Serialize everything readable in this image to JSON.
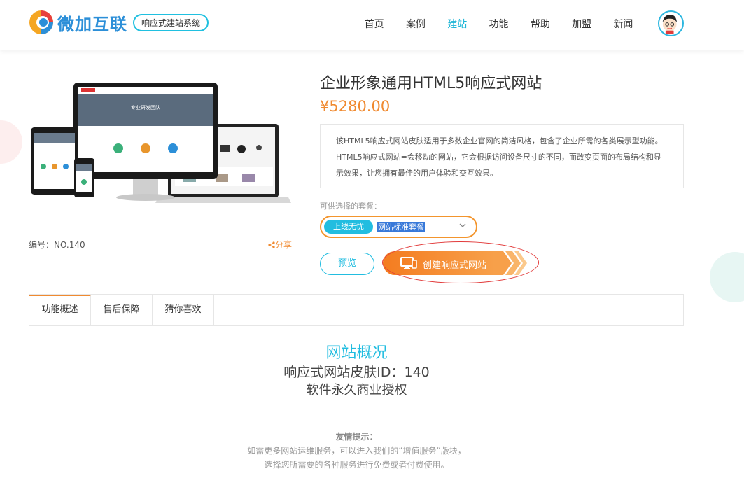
{
  "header": {
    "logo_text": "微加互联",
    "logo_badge": "响应式建站系统",
    "nav": [
      {
        "label": "首页",
        "active": false
      },
      {
        "label": "案例",
        "active": false
      },
      {
        "label": "建站",
        "active": true
      },
      {
        "label": "功能",
        "active": false
      },
      {
        "label": "帮助",
        "active": false
      },
      {
        "label": "加盟",
        "active": false
      },
      {
        "label": "新闻",
        "active": false
      }
    ],
    "avatar_icon": "user-avatar-icon"
  },
  "product": {
    "title": "企业形象通用HTML5响应式网站",
    "price": "¥5280.00",
    "code": "编号：NO.140",
    "share": "分享",
    "screen_banner_text": "专业研发团队",
    "description_line1": "该HTML5响应式网站皮肤适用于多数企业官网的简洁风格，包含了企业所需的各类展示型功能。",
    "description_line2": "HTML5响应式网站=会移动的网站，它会根据访问设备尺寸的不同，而改变页面的布局结构和显",
    "description_line3": "示效果，让您拥有最佳的用户体验和交互效果。",
    "package_label": "可供选择的套餐：",
    "package_tag": "上线无忧",
    "package_value": "网站标准套餐",
    "preview_button": "预览",
    "create_button": "创建响应式网站"
  },
  "tabs": [
    {
      "label": "功能概述",
      "active": true
    },
    {
      "label": "售后保障",
      "active": false
    },
    {
      "label": "猜你喜欢",
      "active": false
    }
  ],
  "content": {
    "heading": "网站概况",
    "line1": "响应式网站皮肤ID：140",
    "line2": "软件永久商业授权",
    "tip_title": "友情提示：",
    "tip_line1": "如需更多网站运维服务，可以进入我们的“增值服务“版块，",
    "tip_line2": "选择您所需要的各种服务进行免费或者付费使用。"
  },
  "colors": {
    "accent": "#22bde0",
    "orange": "#f08a30",
    "annotation_red": "#e23b3b"
  }
}
